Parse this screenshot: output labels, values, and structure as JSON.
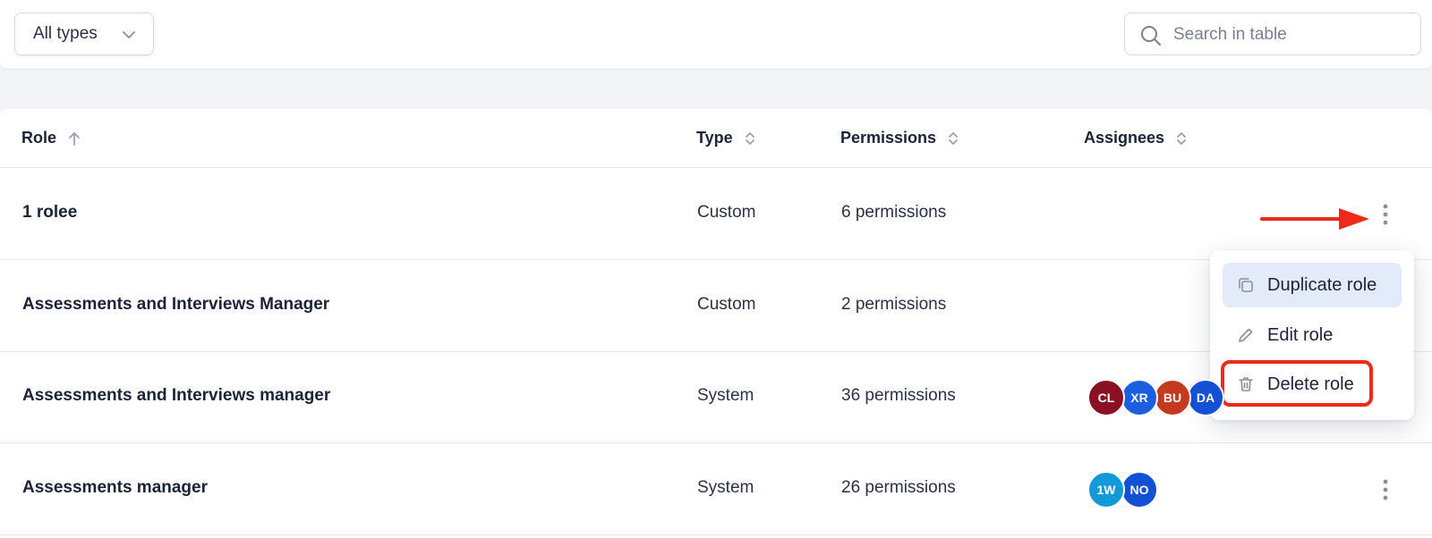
{
  "filters": {
    "type_select_value": "All types",
    "search_placeholder": "Search in table"
  },
  "table": {
    "columns": [
      {
        "label": "Role",
        "sort": "ascending"
      },
      {
        "label": "Type",
        "sort": "none"
      },
      {
        "label": "Permissions",
        "sort": "none"
      },
      {
        "label": "Assignees",
        "sort": "none"
      }
    ],
    "rows": [
      {
        "role": "1 rolee",
        "type": "Custom",
        "permissions": "6 permissions",
        "assignees": []
      },
      {
        "role": "Assessments and Interviews Manager",
        "type": "Custom",
        "permissions": "2 permissions",
        "assignees": []
      },
      {
        "role": "Assessments and Interviews manager",
        "type": "System",
        "permissions": "36 permissions",
        "assignees": [
          {
            "initials": "CL",
            "color": "#8b1024"
          },
          {
            "initials": "XR",
            "color": "#1b5fe0"
          },
          {
            "initials": "BU",
            "color": "#c43a1f"
          },
          {
            "initials": "DA",
            "color": "#1450d4"
          }
        ]
      },
      {
        "role": "Assessments manager",
        "type": "System",
        "permissions": "26 permissions",
        "assignees": [
          {
            "initials": "1W",
            "color": "#129ad8"
          },
          {
            "initials": "NO",
            "color": "#1450d4"
          }
        ]
      }
    ]
  },
  "row_menu": {
    "items": [
      {
        "label": "Duplicate role",
        "icon": "copy-icon",
        "active": true
      },
      {
        "label": "Edit role",
        "icon": "pencil-icon",
        "active": false
      },
      {
        "label": "Delete role",
        "icon": "trash-icon",
        "active": false,
        "highlighted": true
      }
    ]
  },
  "annotation_color": "#ee2a1c"
}
